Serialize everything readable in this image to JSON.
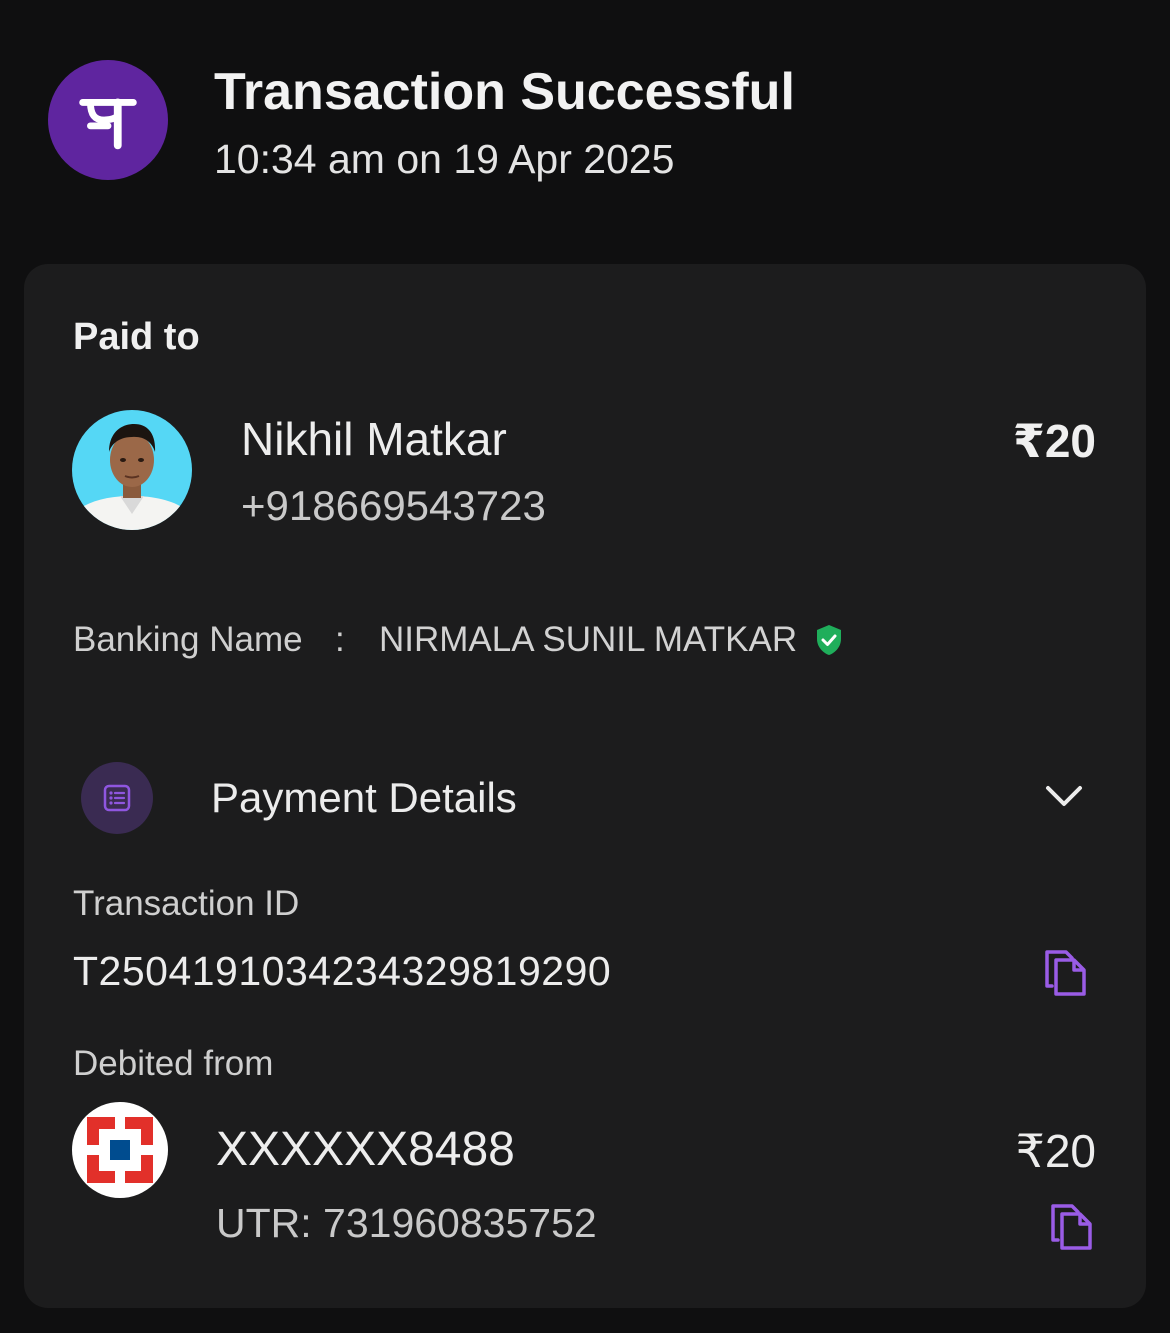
{
  "header": {
    "brand_icon": "phonepe-logo",
    "title": "Transaction Successful",
    "timestamp": "10:34 am on 19 Apr 2025"
  },
  "paid_to": {
    "label": "Paid to",
    "avatar": "payee-photo",
    "name": "Nikhil Matkar",
    "phone": "+918669543723",
    "amount": "₹20"
  },
  "banking": {
    "label": "Banking Name",
    "separator": ":",
    "value": "NIRMALA SUNIL MATKAR",
    "verified_icon": "verified-shield-icon"
  },
  "payment_details": {
    "icon": "receipt-list-icon",
    "label": "Payment Details",
    "expand_icon": "chevron-down-icon"
  },
  "transaction": {
    "label": "Transaction ID",
    "value": "T2504191034234329819290",
    "copy_icon": "copy-icon"
  },
  "debited": {
    "label": "Debited from",
    "bank_icon": "hdfc-bank-logo",
    "account": "XXXXXX8488",
    "utr": "UTR: 731960835752",
    "amount": "₹20",
    "copy_icon": "copy-icon"
  },
  "colors": {
    "background": "#0f0f10",
    "card": "#1c1c1d",
    "brand_purple": "#5f259f",
    "accent_purple": "#9a5ce6",
    "verified_green": "#1fae5b"
  }
}
